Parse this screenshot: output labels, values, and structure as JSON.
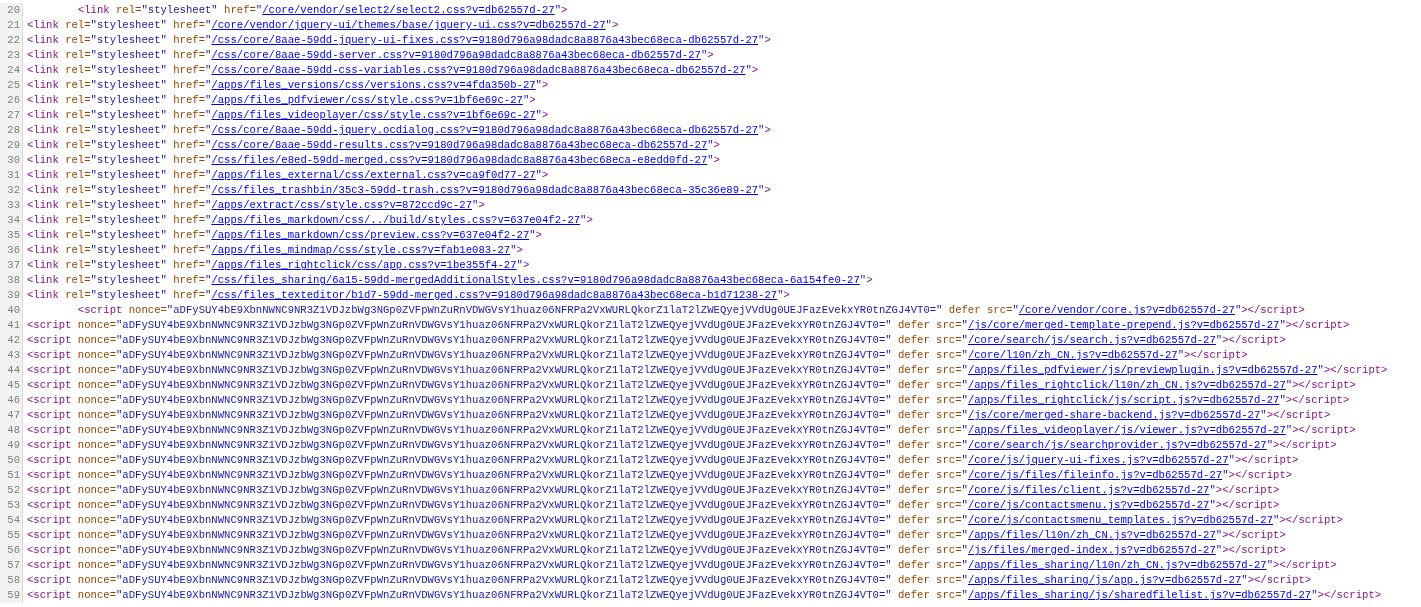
{
  "lines": [
    {
      "number": "20",
      "indented": true,
      "open": "<link",
      "attrs": [
        {
          "name": "rel=",
          "value": "\"stylesheet\"",
          "link": false
        },
        {
          "name": "href=",
          "value": "\"/core/vendor/select2/select2.css?v=db62557d-27\"",
          "link": true
        }
      ],
      "close": ">"
    },
    {
      "number": "21",
      "indented": false,
      "open": "<link",
      "attrs": [
        {
          "name": "rel=",
          "value": "\"stylesheet\"",
          "link": false
        },
        {
          "name": "href=",
          "value": "\"/core/vendor/jquery-ui/themes/base/jquery-ui.css?v=db62557d-27\"",
          "link": true
        }
      ],
      "close": ">"
    },
    {
      "number": "22",
      "indented": false,
      "open": "<link",
      "attrs": [
        {
          "name": "rel=",
          "value": "\"stylesheet\"",
          "link": false
        },
        {
          "name": "href=",
          "value": "\"/css/core/8aae-59dd-jquery-ui-fixes.css?v=9180d796a98dadc8a8876a43bec68eca-db62557d-27\"",
          "link": true
        }
      ],
      "close": ">"
    },
    {
      "number": "23",
      "indented": false,
      "open": "<link",
      "attrs": [
        {
          "name": "rel=",
          "value": "\"stylesheet\"",
          "link": false
        },
        {
          "name": "href=",
          "value": "\"/css/core/8aae-59dd-server.css?v=9180d796a98dadc8a8876a43bec68eca-db62557d-27\"",
          "link": true
        }
      ],
      "close": ">"
    },
    {
      "number": "24",
      "indented": false,
      "open": "<link",
      "attrs": [
        {
          "name": "rel=",
          "value": "\"stylesheet\"",
          "link": false
        },
        {
          "name": "href=",
          "value": "\"/css/core/8aae-59dd-css-variables.css?v=9180d796a98dadc8a8876a43bec68eca-db62557d-27\"",
          "link": true
        }
      ],
      "close": ">"
    },
    {
      "number": "25",
      "indented": false,
      "open": "<link",
      "attrs": [
        {
          "name": "rel=",
          "value": "\"stylesheet\"",
          "link": false
        },
        {
          "name": "href=",
          "value": "\"/apps/files_versions/css/versions.css?v=4fda350b-27\"",
          "link": true
        }
      ],
      "close": ">"
    },
    {
      "number": "26",
      "indented": false,
      "open": "<link",
      "attrs": [
        {
          "name": "rel=",
          "value": "\"stylesheet\"",
          "link": false
        },
        {
          "name": "href=",
          "value": "\"/apps/files_pdfviewer/css/style.css?v=1bf6e69c-27\"",
          "link": true
        }
      ],
      "close": ">"
    },
    {
      "number": "27",
      "indented": false,
      "open": "<link",
      "attrs": [
        {
          "name": "rel=",
          "value": "\"stylesheet\"",
          "link": false
        },
        {
          "name": "href=",
          "value": "\"/apps/files_videoplayer/css/style.css?v=1bf6e69c-27\"",
          "link": true
        }
      ],
      "close": ">"
    },
    {
      "number": "28",
      "indented": false,
      "open": "<link",
      "attrs": [
        {
          "name": "rel=",
          "value": "\"stylesheet\"",
          "link": false
        },
        {
          "name": "href=",
          "value": "\"/css/core/8aae-59dd-jquery.ocdialog.css?v=9180d796a98dadc8a8876a43bec68eca-db62557d-27\"",
          "link": true
        }
      ],
      "close": ">"
    },
    {
      "number": "29",
      "indented": false,
      "open": "<link",
      "attrs": [
        {
          "name": "rel=",
          "value": "\"stylesheet\"",
          "link": false
        },
        {
          "name": "href=",
          "value": "\"/css/core/8aae-59dd-results.css?v=9180d796a98dadc8a8876a43bec68eca-db62557d-27\"",
          "link": true
        }
      ],
      "close": ">"
    },
    {
      "number": "30",
      "indented": false,
      "open": "<link",
      "attrs": [
        {
          "name": "rel=",
          "value": "\"stylesheet\"",
          "link": false
        },
        {
          "name": "href=",
          "value": "\"/css/files/e8ed-59dd-merged.css?v=9180d796a98dadc8a8876a43bec68eca-e8edd0fd-27\"",
          "link": true
        }
      ],
      "close": ">"
    },
    {
      "number": "31",
      "indented": false,
      "open": "<link",
      "attrs": [
        {
          "name": "rel=",
          "value": "\"stylesheet\"",
          "link": false
        },
        {
          "name": "href=",
          "value": "\"/apps/files_external/css/external.css?v=ca9f0d77-27\"",
          "link": true
        }
      ],
      "close": ">"
    },
    {
      "number": "32",
      "indented": false,
      "open": "<link",
      "attrs": [
        {
          "name": "rel=",
          "value": "\"stylesheet\"",
          "link": false
        },
        {
          "name": "href=",
          "value": "\"/css/files_trashbin/35c3-59dd-trash.css?v=9180d796a98dadc8a8876a43bec68eca-35c36e89-27\"",
          "link": true
        }
      ],
      "close": ">"
    },
    {
      "number": "33",
      "indented": false,
      "open": "<link",
      "attrs": [
        {
          "name": "rel=",
          "value": "\"stylesheet\"",
          "link": false
        },
        {
          "name": "href=",
          "value": "\"/apps/extract/css/style.css?v=872ccd9c-27\"",
          "link": true
        }
      ],
      "close": ">"
    },
    {
      "number": "34",
      "indented": false,
      "open": "<link",
      "attrs": [
        {
          "name": "rel=",
          "value": "\"stylesheet\"",
          "link": false
        },
        {
          "name": "href=",
          "value": "\"/apps/files_markdown/css/../build/styles.css?v=637e04f2-27\"",
          "link": true
        }
      ],
      "close": ">"
    },
    {
      "number": "35",
      "indented": false,
      "open": "<link",
      "attrs": [
        {
          "name": "rel=",
          "value": "\"stylesheet\"",
          "link": false
        },
        {
          "name": "href=",
          "value": "\"/apps/files_markdown/css/preview.css?v=637e04f2-27\"",
          "link": true
        }
      ],
      "close": ">"
    },
    {
      "number": "36",
      "indented": false,
      "open": "<link",
      "attrs": [
        {
          "name": "rel=",
          "value": "\"stylesheet\"",
          "link": false
        },
        {
          "name": "href=",
          "value": "\"/apps/files_mindmap/css/style.css?v=fab1e083-27\"",
          "link": true
        }
      ],
      "close": ">"
    },
    {
      "number": "37",
      "indented": false,
      "open": "<link",
      "attrs": [
        {
          "name": "rel=",
          "value": "\"stylesheet\"",
          "link": false
        },
        {
          "name": "href=",
          "value": "\"/apps/files_rightclick/css/app.css?v=1be355f4-27\"",
          "link": true
        }
      ],
      "close": ">"
    },
    {
      "number": "38",
      "indented": false,
      "open": "<link",
      "attrs": [
        {
          "name": "rel=",
          "value": "\"stylesheet\"",
          "link": false
        },
        {
          "name": "href=",
          "value": "\"/css/files_sharing/6a15-59dd-mergedAdditionalStyles.css?v=9180d796a98dadc8a8876a43bec68eca-6a154fe0-27\"",
          "link": true
        }
      ],
      "close": ">"
    },
    {
      "number": "39",
      "indented": false,
      "open": "<link",
      "attrs": [
        {
          "name": "rel=",
          "value": "\"stylesheet\"",
          "link": false
        },
        {
          "name": "href=",
          "value": "\"/css/files_texteditor/b1d7-59dd-merged.css?v=9180d796a98dadc8a8876a43bec68eca-b1d71238-27\"",
          "link": true
        }
      ],
      "close": ">"
    },
    {
      "number": "40",
      "indented": true,
      "open": "<script",
      "attrs": [
        {
          "name": "nonce=",
          "value": "\"aDFySUY4bE9XbnNWNC9NR3Z1VDJzbWg3NGp0ZVFpWnZuRnVDWGVsY1huaz06NFRPa2VxWURLQkorZ1laT2lZWEQyejVVdUg0UEJFazEvekxYR0tnZGJ4VT0=\"",
          "link": false
        },
        {
          "name": "defer",
          "link": false
        },
        {
          "name": "src=",
          "value": "\"/core/vendor/core.js?v=db62557d-27\"",
          "link": true
        }
      ],
      "close": "></script>"
    },
    {
      "number": "41",
      "indented": false,
      "open": "<script",
      "attrs": [
        {
          "name": "nonce=",
          "value": "\"aDFySUY4bE9XbnNWNC9NR3Z1VDJzbWg3NGp0ZVFpWnZuRnVDWGVsY1huaz06NFRPa2VxWURLQkorZ1laT2lZWEQyejVVdUg0UEJFazEvekxYR0tnZGJ4VT0=\"",
          "link": false
        },
        {
          "name": "defer",
          "link": false
        },
        {
          "name": "src=",
          "value": "\"/js/core/merged-template-prepend.js?v=db62557d-27\"",
          "link": true
        }
      ],
      "close": "></script>"
    },
    {
      "number": "42",
      "indented": false,
      "open": "<script",
      "attrs": [
        {
          "name": "nonce=",
          "value": "\"aDFySUY4bE9XbnNWNC9NR3Z1VDJzbWg3NGp0ZVFpWnZuRnVDWGVsY1huaz06NFRPa2VxWURLQkorZ1laT2lZWEQyejVVdUg0UEJFazEvekxYR0tnZGJ4VT0=\"",
          "link": false
        },
        {
          "name": "defer",
          "link": false
        },
        {
          "name": "src=",
          "value": "\"/core/search/js/search.js?v=db62557d-27\"",
          "link": true
        }
      ],
      "close": "></script>"
    },
    {
      "number": "43",
      "indented": false,
      "open": "<script",
      "attrs": [
        {
          "name": "nonce=",
          "value": "\"aDFySUY4bE9XbnNWNC9NR3Z1VDJzbWg3NGp0ZVFpWnZuRnVDWGVsY1huaz06NFRPa2VxWURLQkorZ1laT2lZWEQyejVVdUg0UEJFazEvekxYR0tnZGJ4VT0=\"",
          "link": false
        },
        {
          "name": "defer",
          "link": false
        },
        {
          "name": "src=",
          "value": "\"/core/l10n/zh_CN.js?v=db62557d-27\"",
          "link": true
        }
      ],
      "close": "></script>"
    },
    {
      "number": "44",
      "indented": false,
      "open": "<script",
      "attrs": [
        {
          "name": "nonce=",
          "value": "\"aDFySUY4bE9XbnNWNC9NR3Z1VDJzbWg3NGp0ZVFpWnZuRnVDWGVsY1huaz06NFRPa2VxWURLQkorZ1laT2lZWEQyejVVdUg0UEJFazEvekxYR0tnZGJ4VT0=\"",
          "link": false
        },
        {
          "name": "defer",
          "link": false
        },
        {
          "name": "src=",
          "value": "\"/apps/files_pdfviewer/js/previewplugin.js?v=db62557d-27\"",
          "link": true
        }
      ],
      "close": "></script>"
    },
    {
      "number": "45",
      "indented": false,
      "open": "<script",
      "attrs": [
        {
          "name": "nonce=",
          "value": "\"aDFySUY4bE9XbnNWNC9NR3Z1VDJzbWg3NGp0ZVFpWnZuRnVDWGVsY1huaz06NFRPa2VxWURLQkorZ1laT2lZWEQyejVVdUg0UEJFazEvekxYR0tnZGJ4VT0=\"",
          "link": false
        },
        {
          "name": "defer",
          "link": false
        },
        {
          "name": "src=",
          "value": "\"/apps/files_rightclick/l10n/zh_CN.js?v=db62557d-27\"",
          "link": true
        }
      ],
      "close": "></script>"
    },
    {
      "number": "46",
      "indented": false,
      "open": "<script",
      "attrs": [
        {
          "name": "nonce=",
          "value": "\"aDFySUY4bE9XbnNWNC9NR3Z1VDJzbWg3NGp0ZVFpWnZuRnVDWGVsY1huaz06NFRPa2VxWURLQkorZ1laT2lZWEQyejVVdUg0UEJFazEvekxYR0tnZGJ4VT0=\"",
          "link": false
        },
        {
          "name": "defer",
          "link": false
        },
        {
          "name": "src=",
          "value": "\"/apps/files_rightclick/js/script.js?v=db62557d-27\"",
          "link": true
        }
      ],
      "close": "></script>"
    },
    {
      "number": "47",
      "indented": false,
      "open": "<script",
      "attrs": [
        {
          "name": "nonce=",
          "value": "\"aDFySUY4bE9XbnNWNC9NR3Z1VDJzbWg3NGp0ZVFpWnZuRnVDWGVsY1huaz06NFRPa2VxWURLQkorZ1laT2lZWEQyejVVdUg0UEJFazEvekxYR0tnZGJ4VT0=\"",
          "link": false
        },
        {
          "name": "defer",
          "link": false
        },
        {
          "name": "src=",
          "value": "\"/js/core/merged-share-backend.js?v=db62557d-27\"",
          "link": true
        }
      ],
      "close": "></script>"
    },
    {
      "number": "48",
      "indented": false,
      "open": "<script",
      "attrs": [
        {
          "name": "nonce=",
          "value": "\"aDFySUY4bE9XbnNWNC9NR3Z1VDJzbWg3NGp0ZVFpWnZuRnVDWGVsY1huaz06NFRPa2VxWURLQkorZ1laT2lZWEQyejVVdUg0UEJFazEvekxYR0tnZGJ4VT0=\"",
          "link": false
        },
        {
          "name": "defer",
          "link": false
        },
        {
          "name": "src=",
          "value": "\"/apps/files_videoplayer/js/viewer.js?v=db62557d-27\"",
          "link": true
        }
      ],
      "close": "></script>"
    },
    {
      "number": "49",
      "indented": false,
      "open": "<script",
      "attrs": [
        {
          "name": "nonce=",
          "value": "\"aDFySUY4bE9XbnNWNC9NR3Z1VDJzbWg3NGp0ZVFpWnZuRnVDWGVsY1huaz06NFRPa2VxWURLQkorZ1laT2lZWEQyejVVdUg0UEJFazEvekxYR0tnZGJ4VT0=\"",
          "link": false
        },
        {
          "name": "defer",
          "link": false
        },
        {
          "name": "src=",
          "value": "\"/core/search/js/searchprovider.js?v=db62557d-27\"",
          "link": true
        }
      ],
      "close": "></script>"
    },
    {
      "number": "50",
      "indented": false,
      "open": "<script",
      "attrs": [
        {
          "name": "nonce=",
          "value": "\"aDFySUY4bE9XbnNWNC9NR3Z1VDJzbWg3NGp0ZVFpWnZuRnVDWGVsY1huaz06NFRPa2VxWURLQkorZ1laT2lZWEQyejVVdUg0UEJFazEvekxYR0tnZGJ4VT0=\"",
          "link": false
        },
        {
          "name": "defer",
          "link": false
        },
        {
          "name": "src=",
          "value": "\"/core/js/jquery-ui-fixes.js?v=db62557d-27\"",
          "link": true
        }
      ],
      "close": "></script>"
    },
    {
      "number": "51",
      "indented": false,
      "open": "<script",
      "attrs": [
        {
          "name": "nonce=",
          "value": "\"aDFySUY4bE9XbnNWNC9NR3Z1VDJzbWg3NGp0ZVFpWnZuRnVDWGVsY1huaz06NFRPa2VxWURLQkorZ1laT2lZWEQyejVVdUg0UEJFazEvekxYR0tnZGJ4VT0=\"",
          "link": false
        },
        {
          "name": "defer",
          "link": false
        },
        {
          "name": "src=",
          "value": "\"/core/js/files/fileinfo.js?v=db62557d-27\"",
          "link": true
        }
      ],
      "close": "></script>"
    },
    {
      "number": "52",
      "indented": false,
      "open": "<script",
      "attrs": [
        {
          "name": "nonce=",
          "value": "\"aDFySUY4bE9XbnNWNC9NR3Z1VDJzbWg3NGp0ZVFpWnZuRnVDWGVsY1huaz06NFRPa2VxWURLQkorZ1laT2lZWEQyejVVdUg0UEJFazEvekxYR0tnZGJ4VT0=\"",
          "link": false
        },
        {
          "name": "defer",
          "link": false
        },
        {
          "name": "src=",
          "value": "\"/core/js/files/client.js?v=db62557d-27\"",
          "link": true
        }
      ],
      "close": "></script>"
    },
    {
      "number": "53",
      "indented": false,
      "open": "<script",
      "attrs": [
        {
          "name": "nonce=",
          "value": "\"aDFySUY4bE9XbnNWNC9NR3Z1VDJzbWg3NGp0ZVFpWnZuRnVDWGVsY1huaz06NFRPa2VxWURLQkorZ1laT2lZWEQyejVVdUg0UEJFazEvekxYR0tnZGJ4VT0=\"",
          "link": false
        },
        {
          "name": "defer",
          "link": false
        },
        {
          "name": "src=",
          "value": "\"/core/js/contactsmenu.js?v=db62557d-27\"",
          "link": true
        }
      ],
      "close": "></script>"
    },
    {
      "number": "54",
      "indented": false,
      "open": "<script",
      "attrs": [
        {
          "name": "nonce=",
          "value": "\"aDFySUY4bE9XbnNWNC9NR3Z1VDJzbWg3NGp0ZVFpWnZuRnVDWGVsY1huaz06NFRPa2VxWURLQkorZ1laT2lZWEQyejVVdUg0UEJFazEvekxYR0tnZGJ4VT0=\"",
          "link": false
        },
        {
          "name": "defer",
          "link": false
        },
        {
          "name": "src=",
          "value": "\"/core/js/contactsmenu_templates.js?v=db62557d-27\"",
          "link": true
        }
      ],
      "close": "></script>"
    },
    {
      "number": "55",
      "indented": false,
      "open": "<script",
      "attrs": [
        {
          "name": "nonce=",
          "value": "\"aDFySUY4bE9XbnNWNC9NR3Z1VDJzbWg3NGp0ZVFpWnZuRnVDWGVsY1huaz06NFRPa2VxWURLQkorZ1laT2lZWEQyejVVdUg0UEJFazEvekxYR0tnZGJ4VT0=\"",
          "link": false
        },
        {
          "name": "defer",
          "link": false
        },
        {
          "name": "src=",
          "value": "\"/apps/files/l10n/zh_CN.js?v=db62557d-27\"",
          "link": true
        }
      ],
      "close": "></script>"
    },
    {
      "number": "56",
      "indented": false,
      "open": "<script",
      "attrs": [
        {
          "name": "nonce=",
          "value": "\"aDFySUY4bE9XbnNWNC9NR3Z1VDJzbWg3NGp0ZVFpWnZuRnVDWGVsY1huaz06NFRPa2VxWURLQkorZ1laT2lZWEQyejVVdUg0UEJFazEvekxYR0tnZGJ4VT0=\"",
          "link": false
        },
        {
          "name": "defer",
          "link": false
        },
        {
          "name": "src=",
          "value": "\"/js/files/merged-index.js?v=db62557d-27\"",
          "link": true
        }
      ],
      "close": "></script>"
    },
    {
      "number": "57",
      "indented": false,
      "open": "<script",
      "attrs": [
        {
          "name": "nonce=",
          "value": "\"aDFySUY4bE9XbnNWNC9NR3Z1VDJzbWg3NGp0ZVFpWnZuRnVDWGVsY1huaz06NFRPa2VxWURLQkorZ1laT2lZWEQyejVVdUg0UEJFazEvekxYR0tnZGJ4VT0=\"",
          "link": false
        },
        {
          "name": "defer",
          "link": false
        },
        {
          "name": "src=",
          "value": "\"/apps/files_sharing/l10n/zh_CN.js?v=db62557d-27\"",
          "link": true
        }
      ],
      "close": "></script>"
    },
    {
      "number": "58",
      "indented": false,
      "open": "<script",
      "attrs": [
        {
          "name": "nonce=",
          "value": "\"aDFySUY4bE9XbnNWNC9NR3Z1VDJzbWg3NGp0ZVFpWnZuRnVDWGVsY1huaz06NFRPa2VxWURLQkorZ1laT2lZWEQyejVVdUg0UEJFazEvekxYR0tnZGJ4VT0=\"",
          "link": false
        },
        {
          "name": "defer",
          "link": false
        },
        {
          "name": "src=",
          "value": "\"/apps/files_sharing/js/app.js?v=db62557d-27\"",
          "link": true
        }
      ],
      "close": "></script>"
    },
    {
      "number": "59",
      "indented": false,
      "open": "<script",
      "attrs": [
        {
          "name": "nonce=",
          "value": "\"aDFySUY4bE9XbnNWNC9NR3Z1VDJzbWg3NGp0ZVFpWnZuRnVDWGVsY1huaz06NFRPa2VxWURLQkorZ1laT2lZWEQyejVVdUg0UEJFazEvekxYR0tnZGJ4VT0=\"",
          "link": false
        },
        {
          "name": "defer",
          "link": false
        },
        {
          "name": "src=",
          "value": "\"/apps/files_sharing/js/sharedfilelist.js?v=db62557d-27\"",
          "link": true
        }
      ],
      "close": "></script>"
    }
  ]
}
